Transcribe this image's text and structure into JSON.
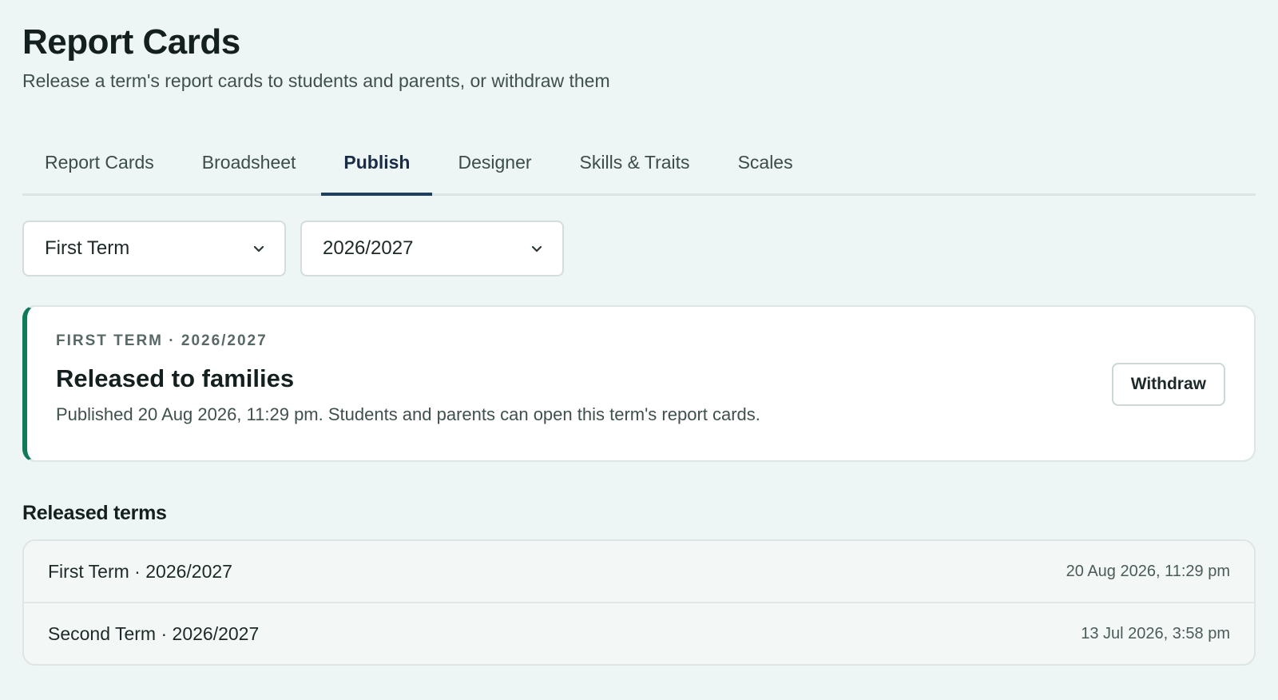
{
  "header": {
    "title": "Report Cards",
    "subtitle": "Release a term's report cards to students and parents, or withdraw them"
  },
  "tabs": [
    {
      "label": "Report Cards",
      "active": false
    },
    {
      "label": "Broadsheet",
      "active": false
    },
    {
      "label": "Publish",
      "active": true
    },
    {
      "label": "Designer",
      "active": false
    },
    {
      "label": "Skills & Traits",
      "active": false
    },
    {
      "label": "Scales",
      "active": false
    }
  ],
  "filters": {
    "term": "First Term",
    "session": "2026/2027"
  },
  "status_card": {
    "eyebrow": "FIRST TERM · 2026/2027",
    "title": "Released to families",
    "description": "Published 20 Aug 2026, 11:29 pm. Students and parents can open this term's report cards.",
    "action_label": "Withdraw",
    "accent_color": "#0e7a5a"
  },
  "released": {
    "title": "Released terms",
    "rows": [
      {
        "name": "First Term · 2026/2027",
        "date": "20 Aug 2026, 11:29 pm"
      },
      {
        "name": "Second Term · 2026/2027",
        "date": "13 Jul 2026, 3:58 pm"
      }
    ]
  },
  "icons": {
    "select_chevron": "chevron-down-icon"
  }
}
